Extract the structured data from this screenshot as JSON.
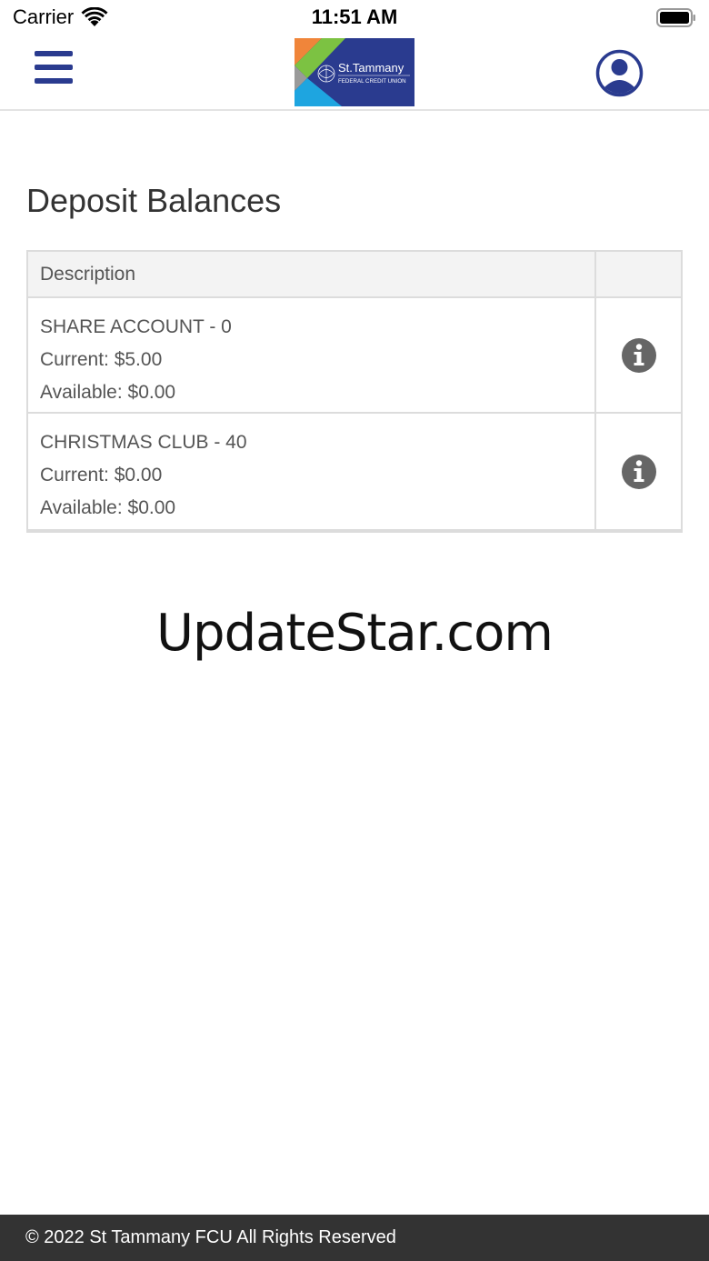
{
  "status_bar": {
    "carrier": "Carrier",
    "time": "11:51 AM",
    "icons": [
      "wifi-icon",
      "battery-icon"
    ]
  },
  "header": {
    "menu_icon": "hamburger-menu-icon",
    "logo": {
      "name": "St.Tammany",
      "subtitle": "FEDERAL CREDIT UNION"
    },
    "profile_icon": "user-circle-icon"
  },
  "main": {
    "title": "Deposit Balances",
    "table": {
      "columns": [
        "Description",
        ""
      ],
      "rows": [
        {
          "name": "SHARE ACCOUNT - 0",
          "current": "Current: $5.00",
          "available": "Available: $0.00",
          "action_icon": "info-icon"
        },
        {
          "name": "CHRISTMAS CLUB - 40",
          "current": "Current: $0.00",
          "available": "Available: $0.00",
          "action_icon": "info-icon"
        }
      ]
    }
  },
  "watermark": "UpdateStar.com",
  "footer": {
    "text": "© 2022 St Tammany FCU All Rights Reserved"
  },
  "colors": {
    "brand_blue": "#2a3b8f",
    "footer_bg": "#333333",
    "info_icon": "#666666",
    "logo_orange": "#f0853a",
    "logo_green": "#7cc242",
    "logo_cyan": "#1ea5e0"
  }
}
